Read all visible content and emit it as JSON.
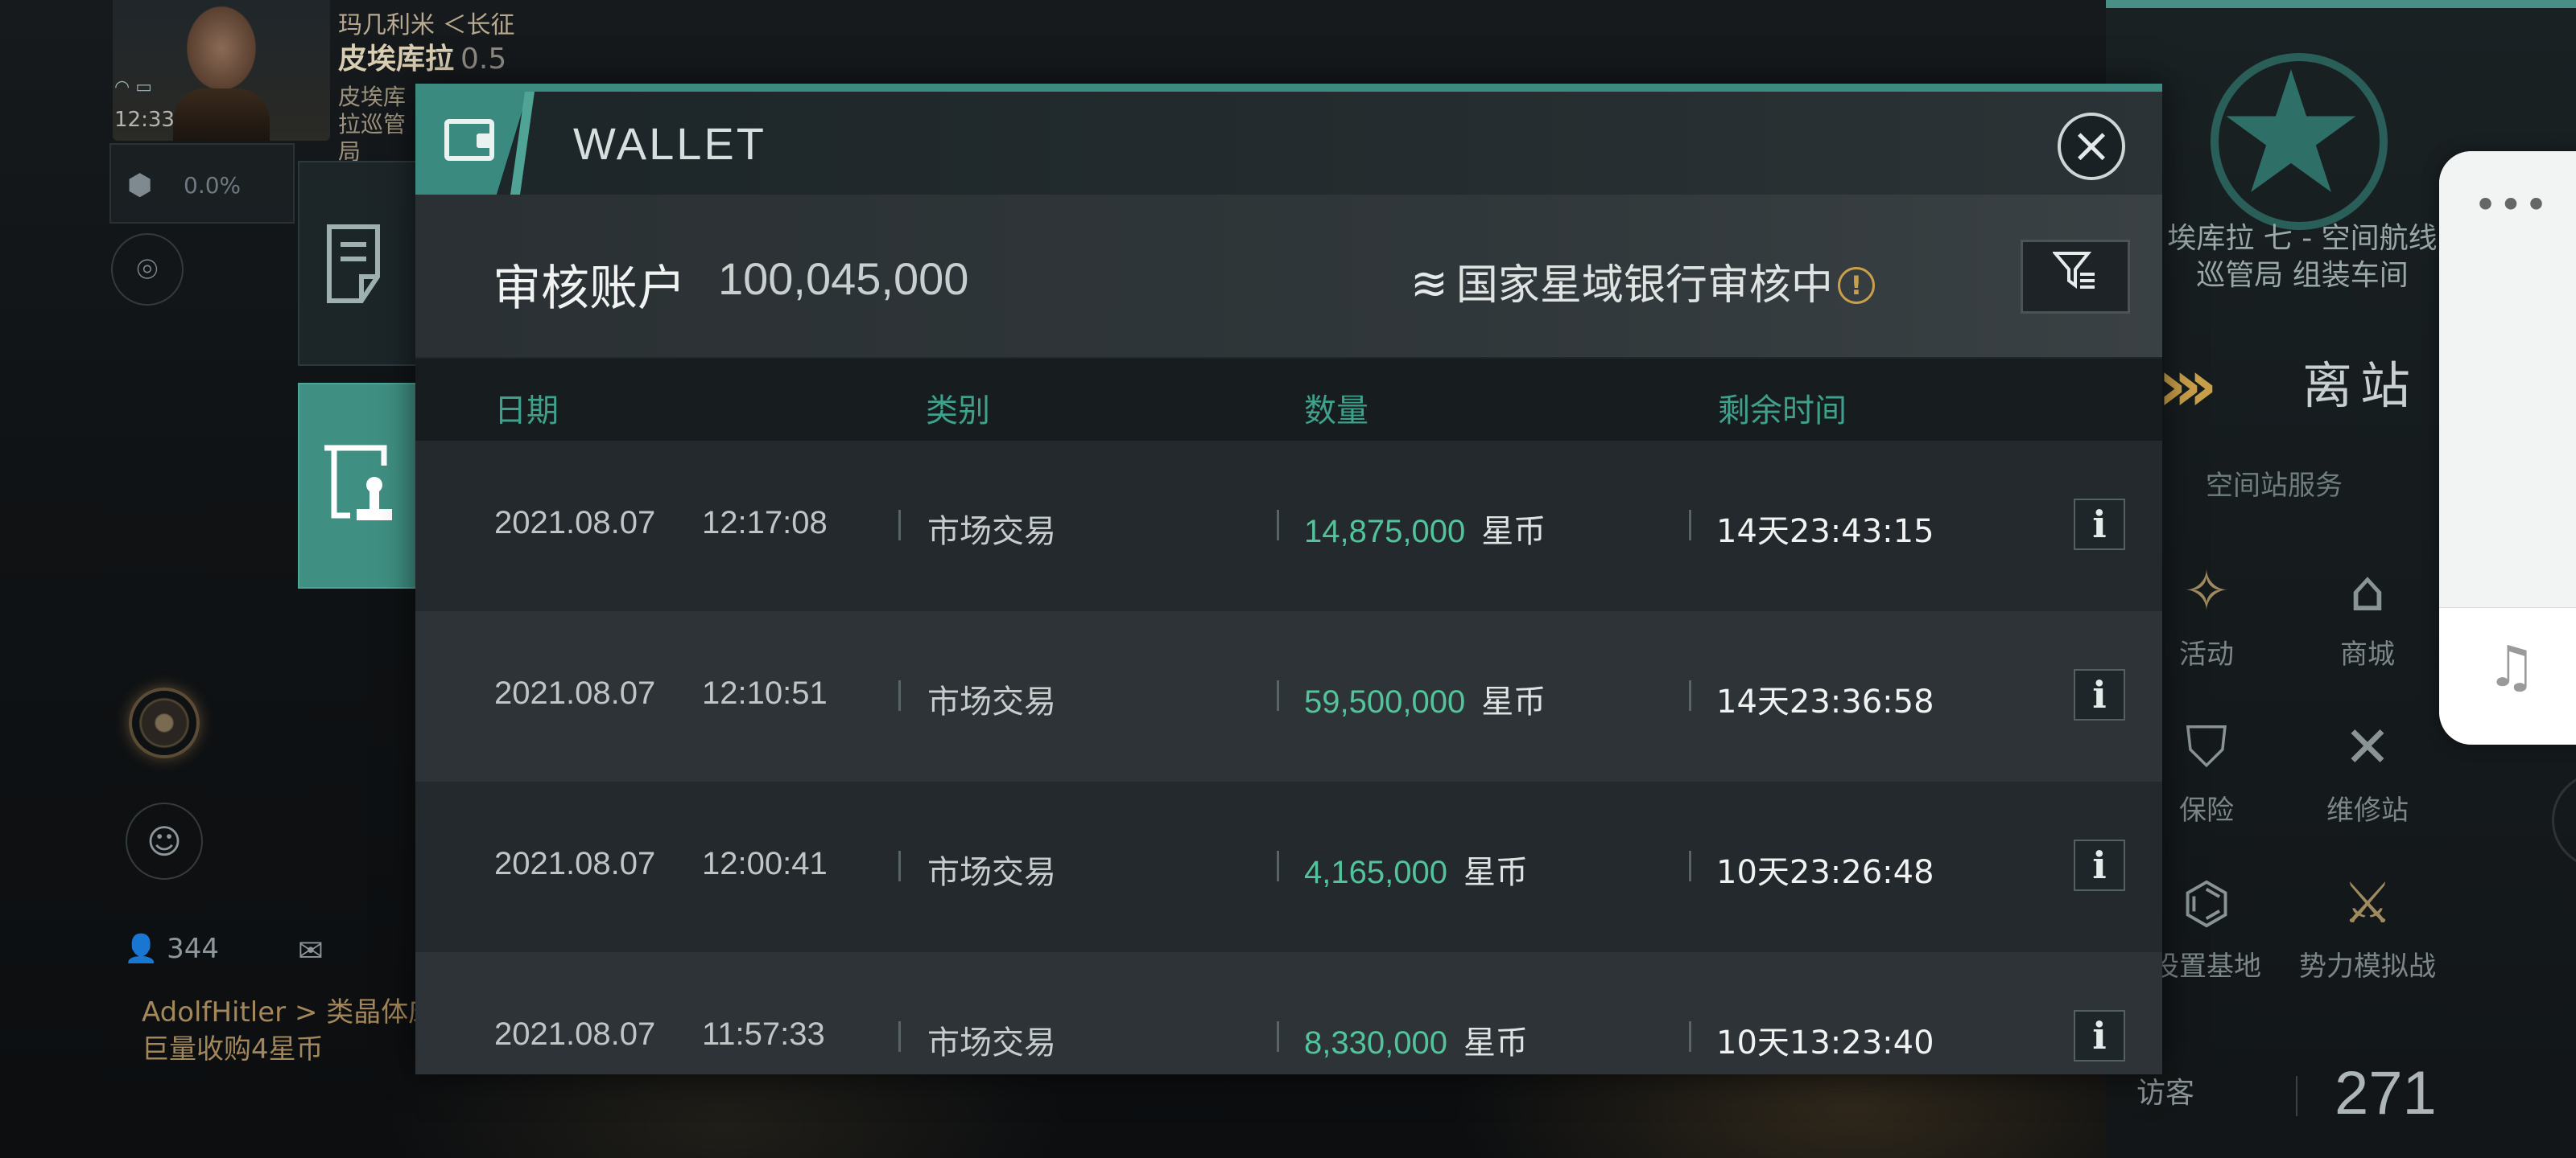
{
  "hud": {
    "player_line1": "玛几利米 ＜长征",
    "player_name": "皮埃库拉",
    "security": "0.5",
    "corp": "皮埃库拉巡管局",
    "clock": "12:33",
    "cargo_pct": "0.0%",
    "contacts_count": "344",
    "chat_line1": "AdolfHitler > 类晶体床",
    "chat_line2": "巨量收购4星币"
  },
  "station": {
    "name": "埃库拉 七 - 空间航线巡管局 组装车间",
    "undock_label": "离站",
    "services_title": "空间站服务",
    "services": [
      {
        "label": "活动",
        "icon": "party-popper-icon"
      },
      {
        "label": "商城",
        "icon": "mall-icon"
      },
      {
        "label": "保险",
        "icon": "shield-icon"
      },
      {
        "label": "维修站",
        "icon": "wrench-icon"
      },
      {
        "label": "设置基地",
        "icon": "base-icon"
      },
      {
        "label": "势力模拟战",
        "icon": "crossed-flags-icon"
      }
    ],
    "visitor_label": "访客",
    "visitor_count": "271"
  },
  "wallet": {
    "title": "WALLET",
    "account_label": "审核账户",
    "account_value": "100,045,000",
    "bank_status": "国家星域银行审核中",
    "columns": {
      "date": "日期",
      "category": "类别",
      "amount": "数量",
      "remaining": "剩余时间"
    },
    "rows": [
      {
        "date": "2021.08.07",
        "time": "12:17:08",
        "category": "市场交易",
        "amount": "14,875,000",
        "unit": "星币",
        "remaining": "14天23:43:15"
      },
      {
        "date": "2021.08.07",
        "time": "12:10:51",
        "category": "市场交易",
        "amount": "59,500,000",
        "unit": "星币",
        "remaining": "14天23:36:58"
      },
      {
        "date": "2021.08.07",
        "time": "12:00:41",
        "category": "市场交易",
        "amount": "4,165,000",
        "unit": "星币",
        "remaining": "10天23:26:48"
      },
      {
        "date": "2021.08.07",
        "time": "11:57:33",
        "category": "市场交易",
        "amount": "8,330,000",
        "unit": "星币",
        "remaining": "10天13:23:40"
      }
    ]
  },
  "colors": {
    "accent": "#3d8b80",
    "column_header": "#3fa08c",
    "amount": "#52c39a",
    "warning": "#c9a04a"
  }
}
